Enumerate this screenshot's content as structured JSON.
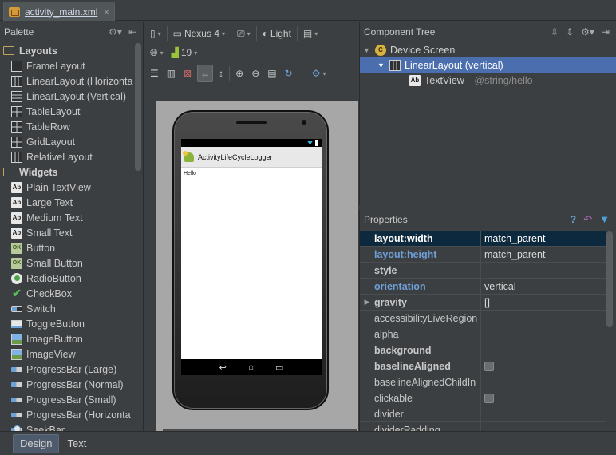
{
  "file_tab": {
    "name": "activity_main.xml",
    "close": "×"
  },
  "palette": {
    "title": "Palette",
    "groups": [
      {
        "label": "Layouts",
        "items": [
          {
            "label": "FrameLayout",
            "icon": "framelayout-icon"
          },
          {
            "label": "LinearLayout (Horizonta",
            "icon": "linearlayout-horizontal-icon"
          },
          {
            "label": "LinearLayout (Vertical)",
            "icon": "linearlayout-vertical-icon"
          },
          {
            "label": "TableLayout",
            "icon": "tablelayout-icon"
          },
          {
            "label": "TableRow",
            "icon": "tablerow-icon"
          },
          {
            "label": "GridLayout",
            "icon": "gridlayout-icon"
          },
          {
            "label": "RelativeLayout",
            "icon": "relativelayout-icon"
          }
        ]
      },
      {
        "label": "Widgets",
        "items": [
          {
            "label": "Plain TextView",
            "icon": "textview-icon"
          },
          {
            "label": "Large Text",
            "icon": "textview-icon"
          },
          {
            "label": "Medium Text",
            "icon": "textview-icon"
          },
          {
            "label": "Small Text",
            "icon": "textview-icon"
          },
          {
            "label": "Button",
            "icon": "button-icon"
          },
          {
            "label": "Small Button",
            "icon": "button-icon"
          },
          {
            "label": "RadioButton",
            "icon": "radiobutton-icon"
          },
          {
            "label": "CheckBox",
            "icon": "checkbox-icon"
          },
          {
            "label": "Switch",
            "icon": "switch-icon"
          },
          {
            "label": "ToggleButton",
            "icon": "togglebutton-icon"
          },
          {
            "label": "ImageButton",
            "icon": "imagebutton-icon"
          },
          {
            "label": "ImageView",
            "icon": "imageview-icon"
          },
          {
            "label": "ProgressBar (Large)",
            "icon": "progressbar-icon"
          },
          {
            "label": "ProgressBar (Normal)",
            "icon": "progressbar-icon"
          },
          {
            "label": "ProgressBar (Small)",
            "icon": "progressbar-icon"
          },
          {
            "label": "ProgressBar (Horizonta",
            "icon": "progressbar-icon"
          },
          {
            "label": "SeekBar",
            "icon": "seekbar-icon"
          }
        ]
      }
    ]
  },
  "design_toolbar": {
    "device": "Nexus 4",
    "theme": "Light",
    "api_level": "19"
  },
  "preview": {
    "app_title": "ActivityLifeCycleLogger",
    "content_text": "Hello",
    "nav_back": "↩",
    "nav_home": "⌂",
    "nav_recent": "▭"
  },
  "component_tree": {
    "title": "Component Tree",
    "nodes": [
      {
        "label": "Device Screen",
        "hint": ""
      },
      {
        "label": "LinearLayout (vertical)",
        "hint": ""
      },
      {
        "label": "TextView",
        "hint": "- @string/hello"
      }
    ]
  },
  "properties": {
    "title": "Properties",
    "rows": [
      {
        "key": "layout:width",
        "value": "match_parent"
      },
      {
        "key": "layout:height",
        "value": "match_parent"
      },
      {
        "key": "style",
        "value": ""
      },
      {
        "key": "orientation",
        "value": "vertical"
      },
      {
        "key": "gravity",
        "value": "[]"
      },
      {
        "key": "accessibilityLiveRegion",
        "value": ""
      },
      {
        "key": "alpha",
        "value": ""
      },
      {
        "key": "background",
        "value": ""
      },
      {
        "key": "baselineAligned",
        "value": ""
      },
      {
        "key": "baselineAlignedChildIn",
        "value": ""
      },
      {
        "key": "clickable",
        "value": ""
      },
      {
        "key": "divider",
        "value": ""
      },
      {
        "key": "dividerPadding",
        "value": ""
      }
    ]
  },
  "bottom_tabs": {
    "design": "Design",
    "text": "Text"
  },
  "colors": {
    "selection": "#4b6eaf",
    "property_selection": "#0d293e",
    "accent": "#6e9fd8"
  }
}
